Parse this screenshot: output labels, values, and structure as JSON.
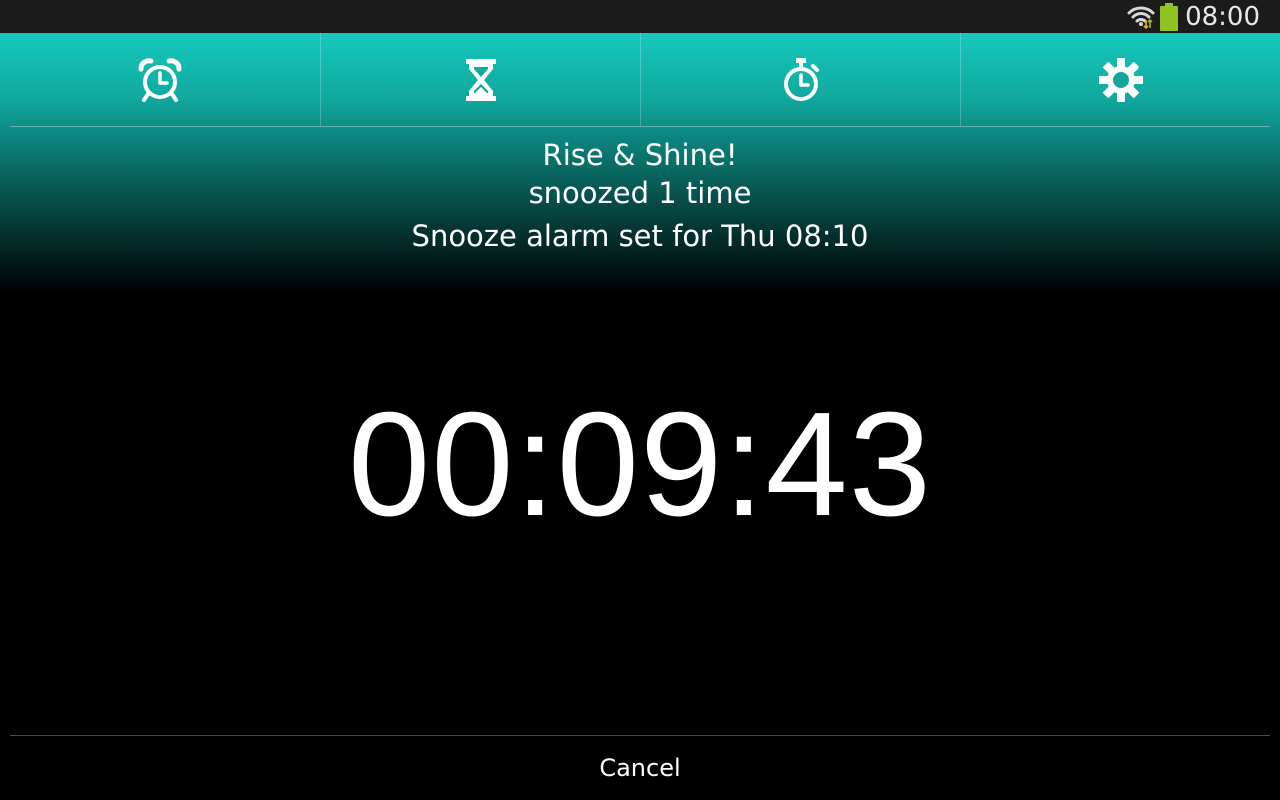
{
  "status_bar": {
    "time": "08:00",
    "icons": [
      "wifi-icon",
      "battery-icon"
    ],
    "battery_color": "#8fc31f"
  },
  "tabs": [
    {
      "icon": "alarm-clock-icon"
    },
    {
      "icon": "hourglass-icon"
    },
    {
      "icon": "stopwatch-icon"
    },
    {
      "icon": "gear-icon"
    }
  ],
  "alarm": {
    "title": "Rise & Shine!",
    "snooze_count": "snoozed 1 time",
    "snooze_info": "Snooze alarm set for Thu 08:10"
  },
  "countdown": "00:09:43",
  "cancel_label": "Cancel",
  "colors": {
    "accent": "#16c9bd",
    "background": "#000000"
  }
}
